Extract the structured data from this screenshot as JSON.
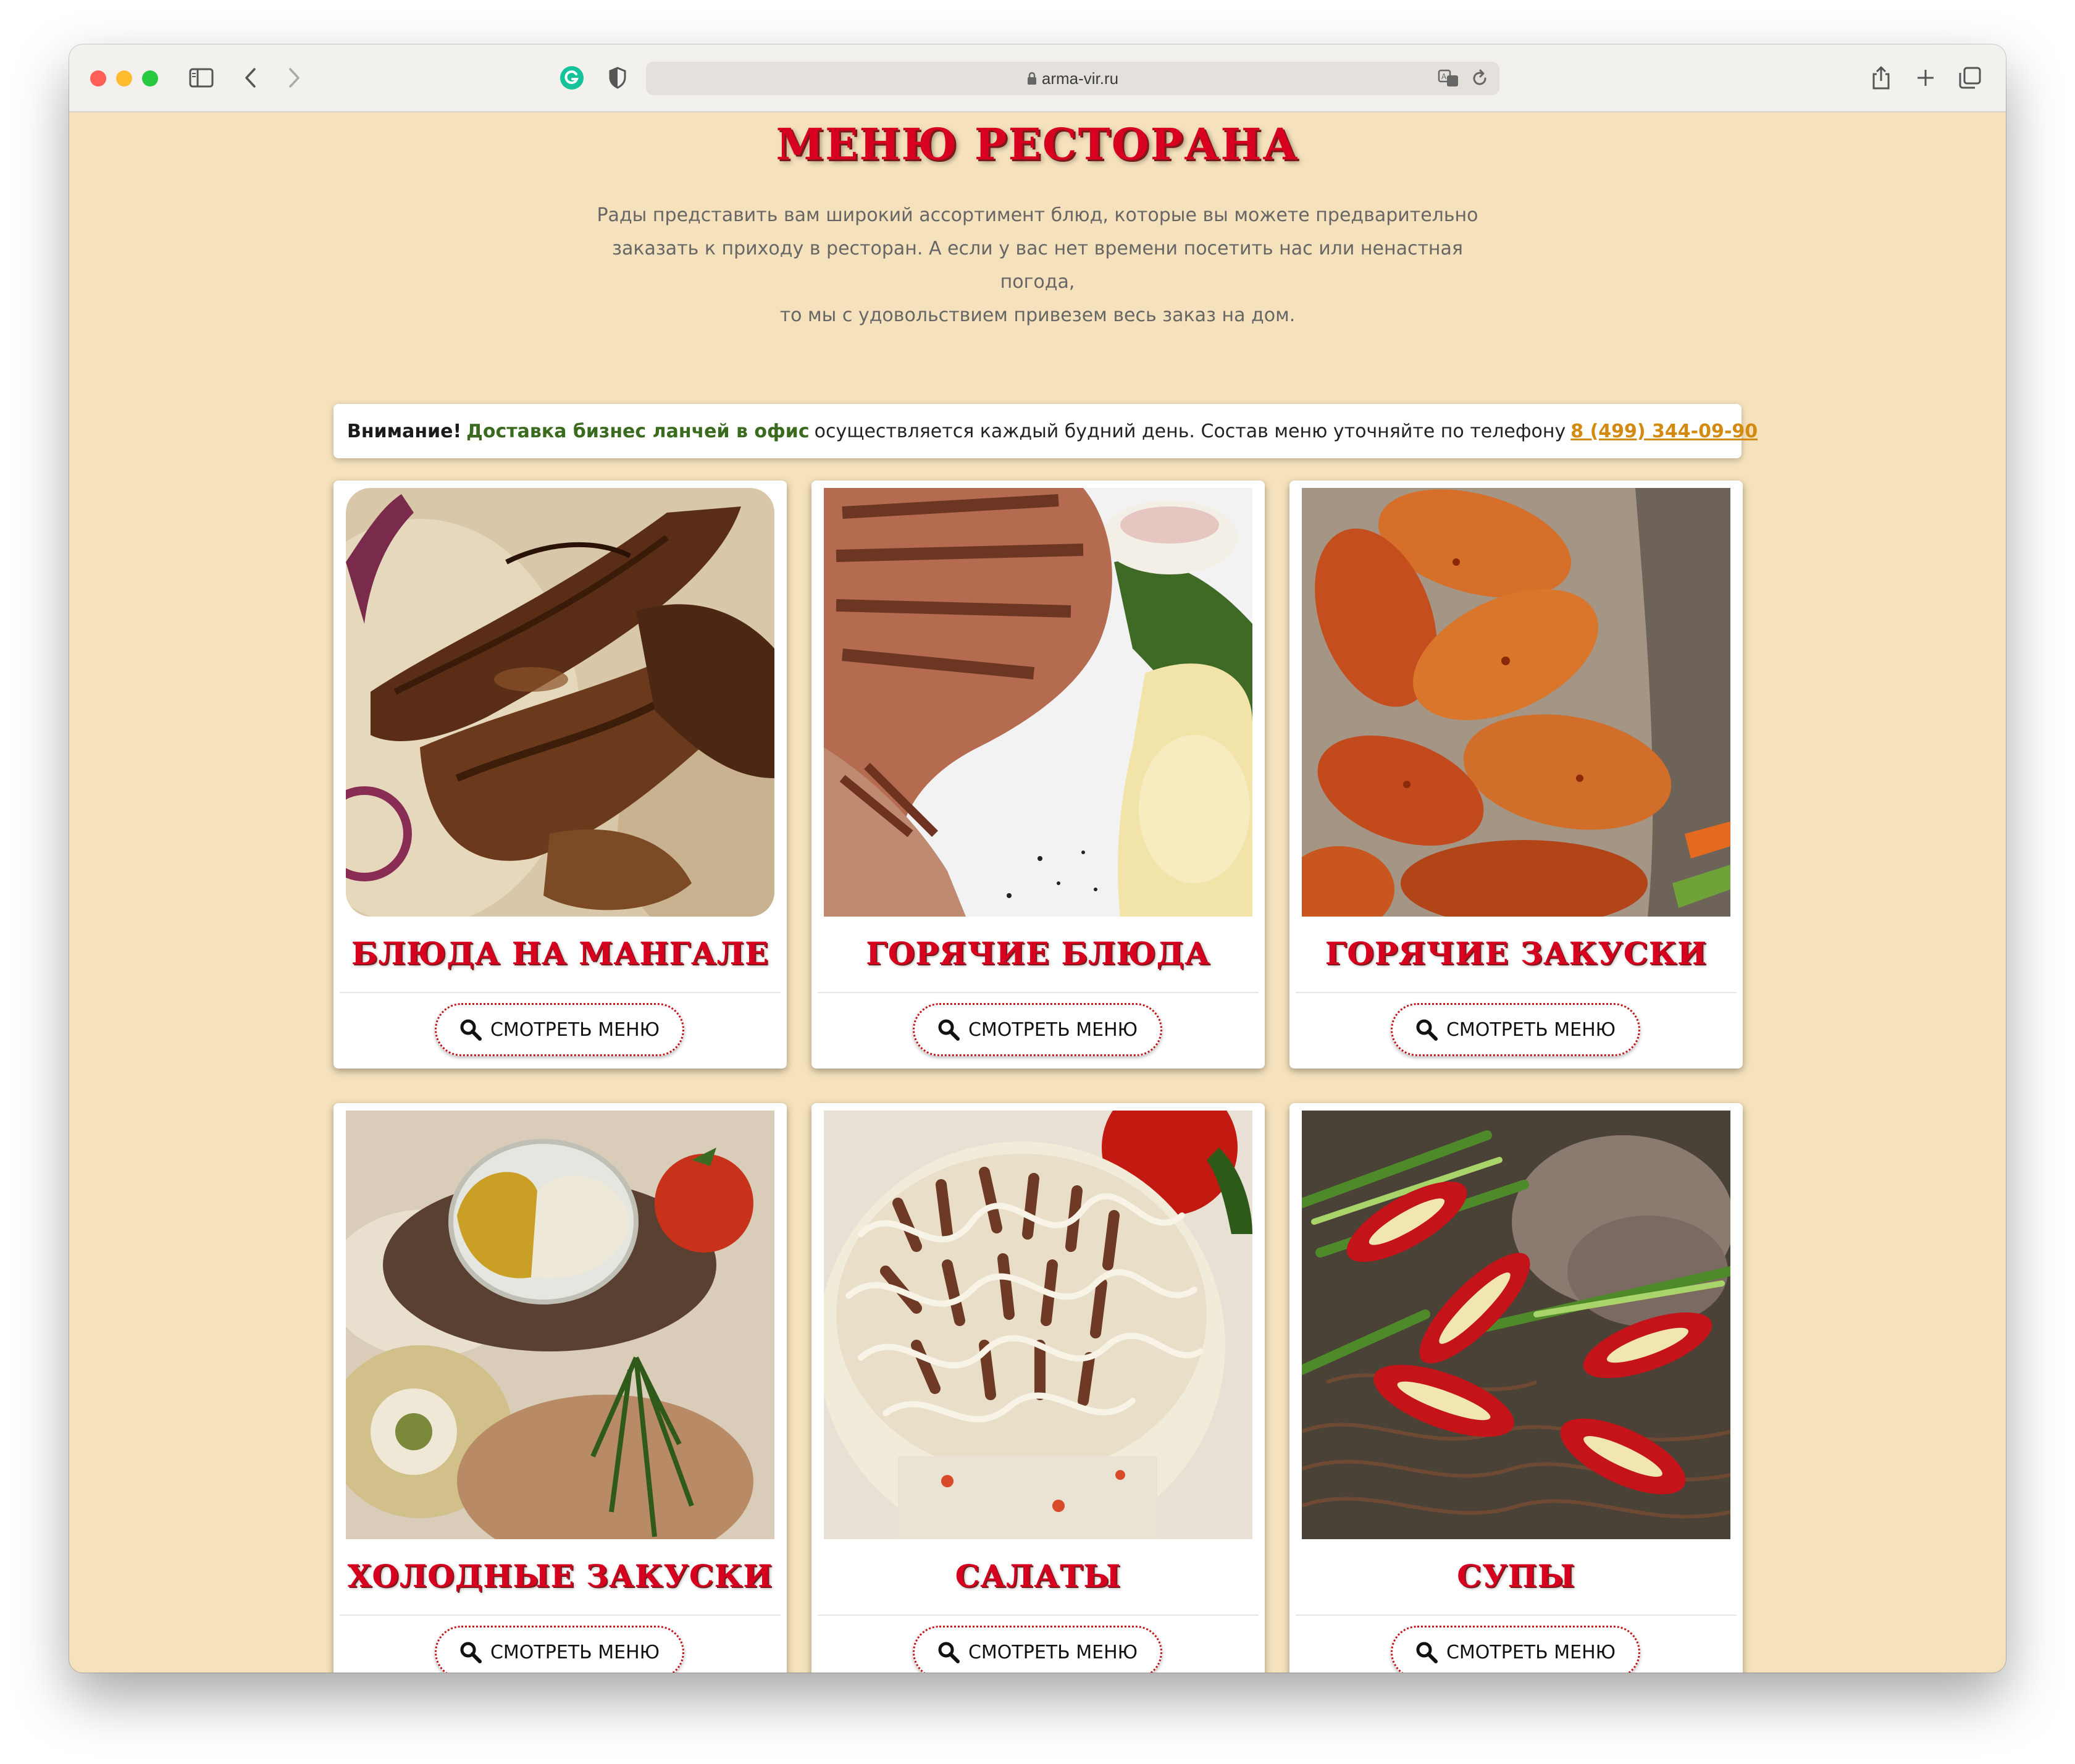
{
  "browser": {
    "url": "arma-vir.ru"
  },
  "page": {
    "title": "МЕНЮ РЕСТОРАНА",
    "intro_lines": [
      "Рады представить вам широкий ассортимент блюд, которые вы можете предварительно",
      "заказать к приходу в ресторан. А если у вас нет времени посетить нас или ненастная погода,",
      "то мы с удовольствием привезем весь заказ на дом."
    ],
    "notice": {
      "attention": "Внимание!",
      "highlight": "Доставка бизнес ланчей в офис",
      "text": "осуществляется каждый будний день. Состав меню уточняйте по телефону",
      "phone": "8 (499) 344-09-90"
    }
  },
  "colors": {
    "page_background": "#f5e2bc",
    "title_red": "#d7001f",
    "notice_green": "#3a6a1e",
    "phone_orange": "#d28a11",
    "button_border": "#c2161c"
  },
  "cards": [
    {
      "title": "БЛЮДА НА МАНГАЛЕ",
      "button_label": "СМОТРЕТЬ МЕНЮ",
      "button_icon": "search-icon"
    },
    {
      "title": "ГОРЯЧИЕ БЛЮДА",
      "button_label": "СМОТРЕТЬ МЕНЮ",
      "button_icon": "search-icon"
    },
    {
      "title": "ГОРЯЧИЕ ЗАКУСКИ",
      "button_label": "СМОТРЕТЬ МЕНЮ",
      "button_icon": "search-icon"
    },
    {
      "title": "ХОЛОДНЫЕ ЗАКУСКИ",
      "button_label": "СМОТРЕТЬ МЕНЮ",
      "button_icon": "search-icon"
    },
    {
      "title": "САЛАТЫ",
      "button_label": "СМОТРЕТЬ МЕНЮ",
      "button_icon": "search-icon"
    },
    {
      "title": "СУПЫ",
      "button_label": "СМОТРЕТЬ МЕНЮ",
      "button_icon": "search-icon"
    }
  ]
}
